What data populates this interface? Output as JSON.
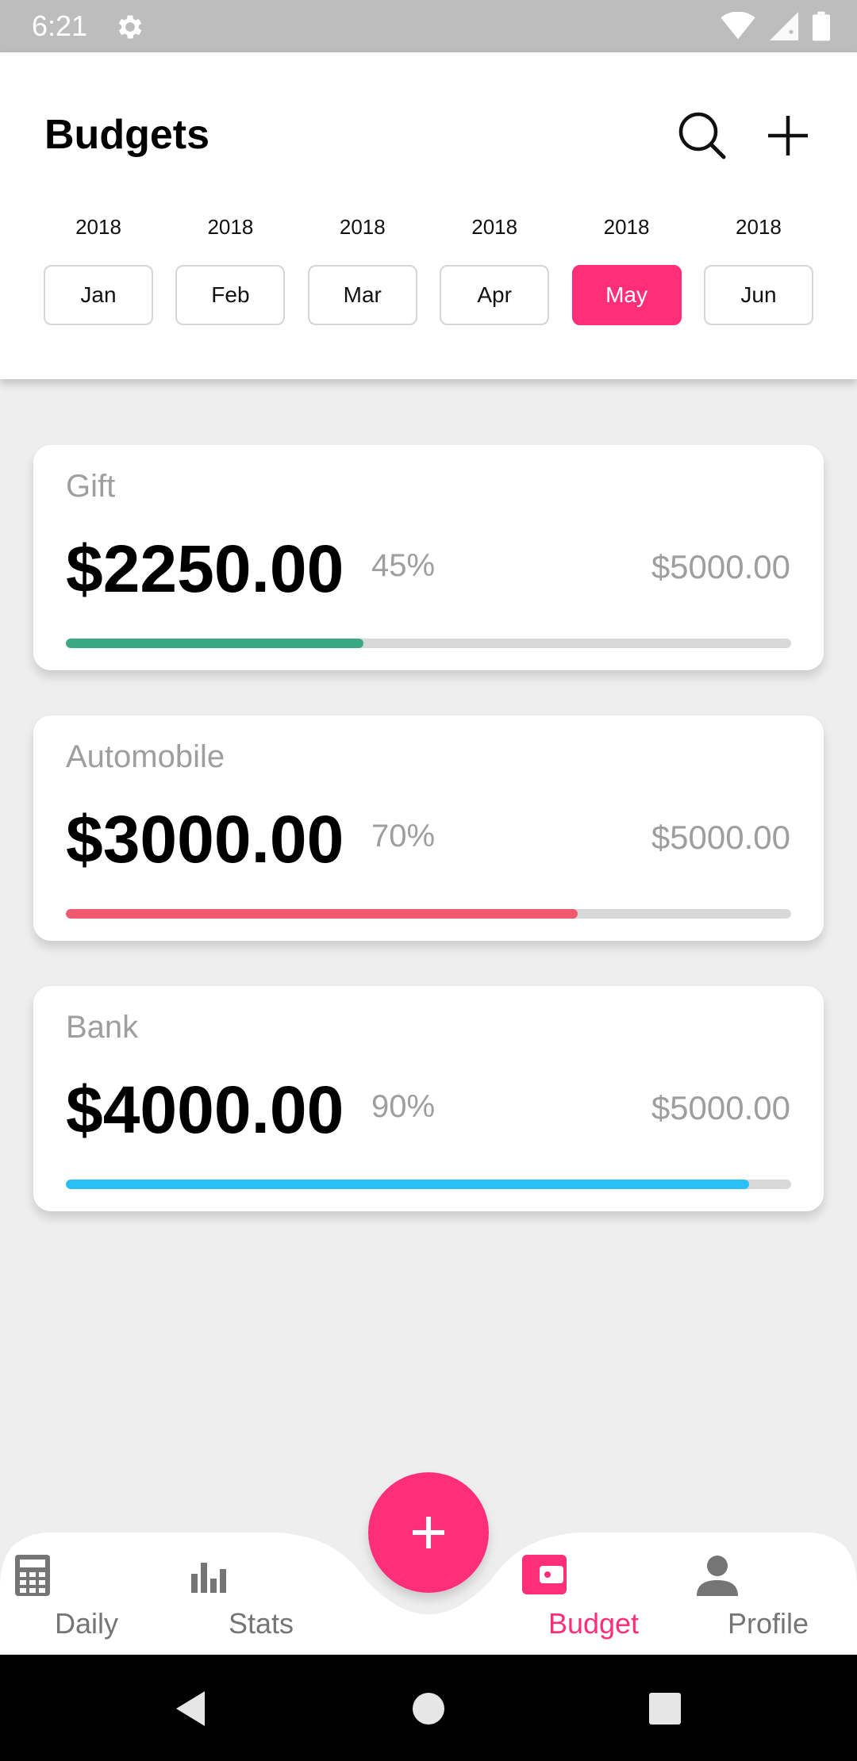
{
  "status_bar": {
    "time": "6:21"
  },
  "header": {
    "title": "Budgets"
  },
  "months": [
    {
      "year": "2018",
      "label": "Jan",
      "active": false
    },
    {
      "year": "2018",
      "label": "Feb",
      "active": false
    },
    {
      "year": "2018",
      "label": "Mar",
      "active": false
    },
    {
      "year": "2018",
      "label": "Apr",
      "active": false
    },
    {
      "year": "2018",
      "label": "May",
      "active": true
    },
    {
      "year": "2018",
      "label": "Jun",
      "active": false
    }
  ],
  "budgets": [
    {
      "label": "Gift",
      "amount": "$2250.00",
      "percent": "45%",
      "total": "$5000.00",
      "progress": 0.41,
      "color": "#3aa983"
    },
    {
      "label": "Automobile",
      "amount": "$3000.00",
      "percent": "70%",
      "total": "$5000.00",
      "progress": 0.706,
      "color": "#ef5a6f"
    },
    {
      "label": "Bank",
      "amount": "$4000.00",
      "percent": "90%",
      "total": "$5000.00",
      "progress": 0.942,
      "color": "#29c0f6"
    }
  ],
  "bottom_nav": [
    {
      "label": "Daily",
      "icon": "calculator-icon"
    },
    {
      "label": "Stats",
      "icon": "bar-chart-icon"
    },
    {
      "label": "Budget",
      "icon": "wallet-icon"
    },
    {
      "label": "Profile",
      "icon": "person-icon"
    }
  ],
  "colors": {
    "accent": "#ff2e79",
    "inactive": "#757575"
  }
}
